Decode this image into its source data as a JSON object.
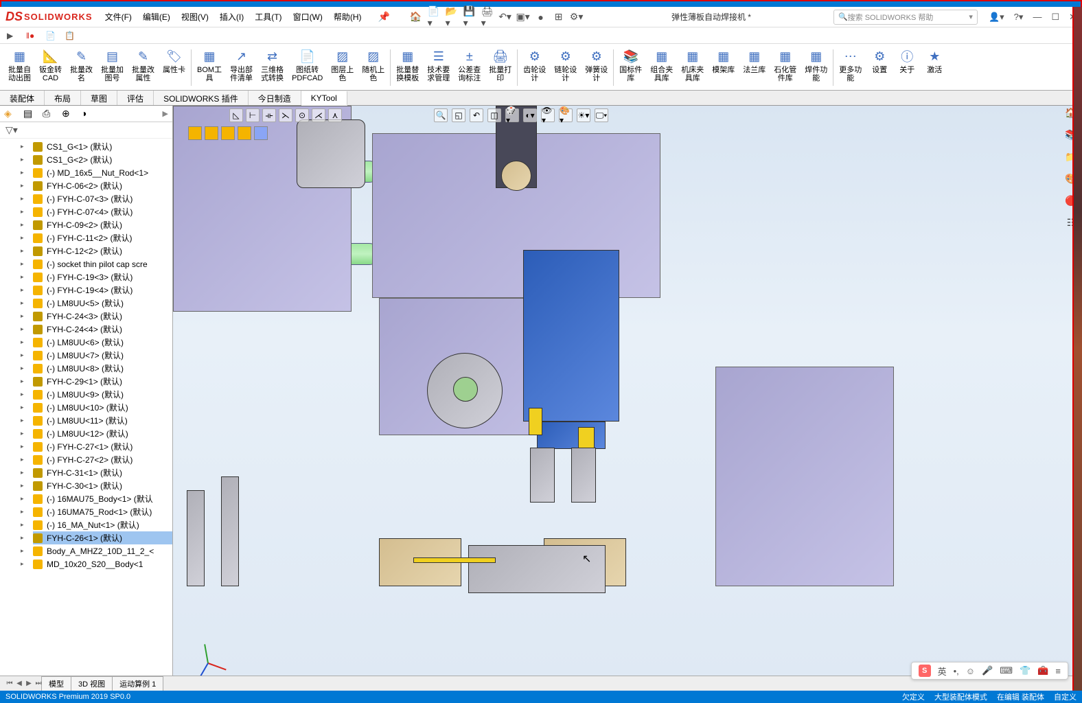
{
  "app": {
    "logo_prefix": "DS",
    "logo_text": "SOLIDWORKS"
  },
  "menu": [
    "文件(F)",
    "编辑(E)",
    "视图(V)",
    "插入(I)",
    "工具(T)",
    "窗口(W)",
    "帮助(H)"
  ],
  "doc_title": "弹性薄板自动焊接机 *",
  "search_placeholder": "搜索 SOLIDWORKS 帮助",
  "ribbon": [
    {
      "lbl": "批量自\n动出图"
    },
    {
      "lbl": "钣金转\nCAD"
    },
    {
      "lbl": "批量改\n名"
    },
    {
      "lbl": "批量加\n图号"
    },
    {
      "lbl": "批量改\n属性"
    },
    {
      "lbl": "属性卡"
    },
    {
      "sep": true
    },
    {
      "lbl": "BOM工\n具"
    },
    {
      "lbl": "导出部\n件清单"
    },
    {
      "lbl": "三维格\n式转换"
    },
    {
      "lbl": "图纸转\nPDFCAD"
    },
    {
      "lbl": "图层上\n色"
    },
    {
      "lbl": "随机上\n色"
    },
    {
      "sep": true
    },
    {
      "lbl": "批量替\n换模板"
    },
    {
      "lbl": "技术要\n求管理"
    },
    {
      "lbl": "公差查\n询标注"
    },
    {
      "lbl": "批量打\n印"
    },
    {
      "sep": true
    },
    {
      "lbl": "齿轮设\n计"
    },
    {
      "lbl": "链轮设\n计"
    },
    {
      "lbl": "弹簧设\n计"
    },
    {
      "sep": true
    },
    {
      "lbl": "国标件\n库"
    },
    {
      "lbl": "组合夹\n具库"
    },
    {
      "lbl": "机床夹\n具库"
    },
    {
      "lbl": "模架库"
    },
    {
      "lbl": "法兰库"
    },
    {
      "lbl": "石化管\n件库"
    },
    {
      "lbl": "焊件功\n能"
    },
    {
      "sep": true
    },
    {
      "lbl": "更多功\n能"
    },
    {
      "lbl": "设置"
    },
    {
      "lbl": "关于"
    },
    {
      "lbl": "激活"
    }
  ],
  "tabs": [
    "装配体",
    "布局",
    "草图",
    "评估",
    "SOLIDWORKS 插件",
    "今日制造",
    "KYTool"
  ],
  "active_tab": 6,
  "tree": [
    {
      "t": "CS1_G<1> (默认)",
      "f": true
    },
    {
      "t": "CS1_G<2> (默认)",
      "f": true
    },
    {
      "t": "(-) MD_16x5__Nut_Rod<1>"
    },
    {
      "t": "FYH-C-06<2> (默认)",
      "f": true
    },
    {
      "t": "(-) FYH-C-07<3> (默认)"
    },
    {
      "t": "(-) FYH-C-07<4> (默认)"
    },
    {
      "t": "FYH-C-09<2> (默认)",
      "f": true
    },
    {
      "t": "(-) FYH-C-11<2> (默认)"
    },
    {
      "t": "FYH-C-12<2> (默认)",
      "f": true
    },
    {
      "t": "(-) socket thin pilot cap scre"
    },
    {
      "t": "(-) FYH-C-19<3> (默认)"
    },
    {
      "t": "(-) FYH-C-19<4> (默认)"
    },
    {
      "t": "(-) LM8UU<5> (默认)"
    },
    {
      "t": "FYH-C-24<3> (默认)",
      "f": true
    },
    {
      "t": "FYH-C-24<4> (默认)",
      "f": true
    },
    {
      "t": "(-) LM8UU<6> (默认)"
    },
    {
      "t": "(-) LM8UU<7> (默认)"
    },
    {
      "t": "(-) LM8UU<8> (默认)"
    },
    {
      "t": "FYH-C-29<1> (默认)",
      "f": true
    },
    {
      "t": "(-) LM8UU<9> (默认)"
    },
    {
      "t": "(-) LM8UU<10> (默认)"
    },
    {
      "t": "(-) LM8UU<11> (默认)"
    },
    {
      "t": "(-) LM8UU<12> (默认)"
    },
    {
      "t": "(-) FYH-C-27<1> (默认)"
    },
    {
      "t": "(-) FYH-C-27<2> (默认)"
    },
    {
      "t": "FYH-C-31<1> (默认)",
      "f": true
    },
    {
      "t": "FYH-C-30<1> (默认)",
      "f": true
    },
    {
      "t": "(-) 16MAU75_Body<1> (默认"
    },
    {
      "t": "(-) 16UMA75_Rod<1> (默认)"
    },
    {
      "t": "(-) 16_MA_Nut<1> (默认)"
    },
    {
      "t": "FYH-C-26<1> (默认)",
      "f": true,
      "sel": true
    },
    {
      "t": "Body_A_MHZ2_10D_11_2_<"
    },
    {
      "t": "MD_10x20_S20__Body<1"
    }
  ],
  "bottom_tabs": [
    "模型",
    "3D 视图",
    "运动算例 1"
  ],
  "status": {
    "left": "SOLIDWORKS Premium 2019 SP0.0",
    "right": [
      "欠定义",
      "大型装配体模式",
      "在编辑 装配体",
      "自定义"
    ]
  },
  "ime_lang": "英"
}
